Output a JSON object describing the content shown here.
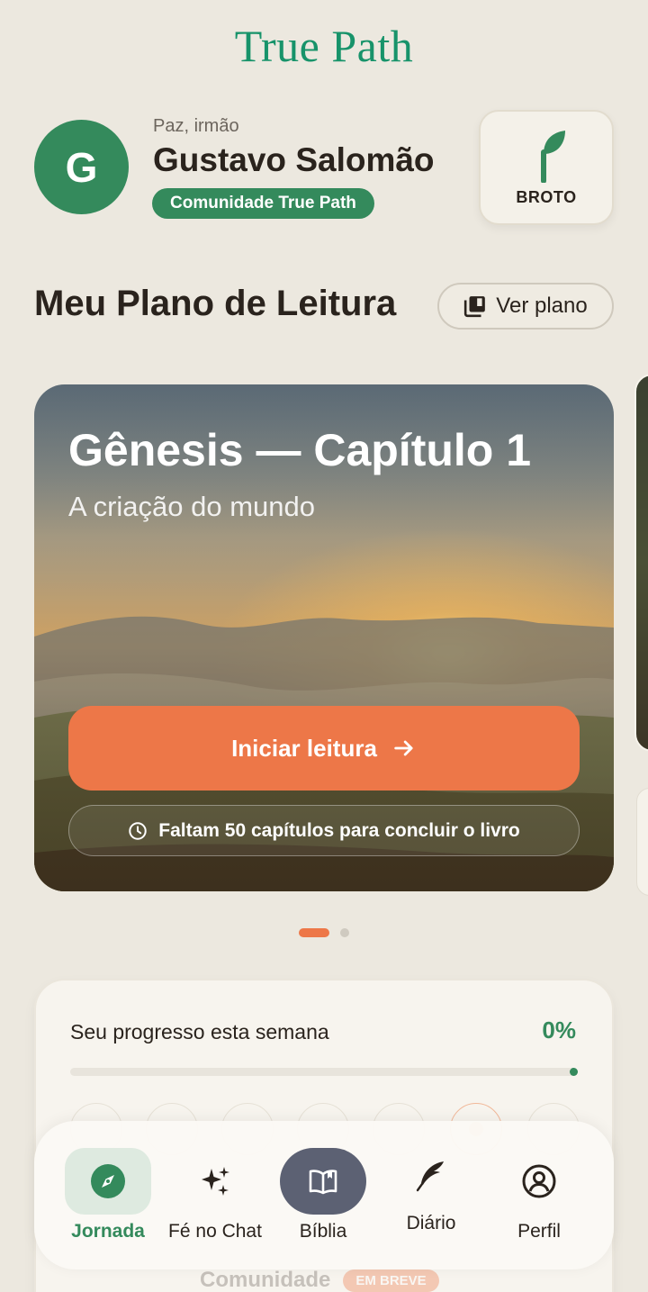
{
  "app": {
    "brand": "True Path"
  },
  "profile": {
    "greeting": "Paz, irmão",
    "name": "Gustavo Salomão",
    "initial": "G",
    "community_badge": "Comunidade True Path",
    "level_label": "BROTO",
    "level_icon": "sprout-icon"
  },
  "reading_plan": {
    "title": "Meu Plano de Leitura",
    "view_plan_label": "Ver plano",
    "card": {
      "title": "Gênesis — Capítulo 1",
      "subtitle": "A criação do mundo",
      "start_label": "Iniciar leitura",
      "remaining_text": "Faltam 50 capítulos para concluir o livro"
    },
    "carousel": {
      "total": 2,
      "active_index": 0
    }
  },
  "weekly_progress": {
    "label": "Seu progresso esta semana",
    "value_text": "0%",
    "value": 0
  },
  "community_teaser": {
    "label": "Comunidade",
    "badge": "EM BREVE"
  },
  "bottom_nav": {
    "items": [
      {
        "label": "Jornada",
        "icon": "compass-icon",
        "active": true
      },
      {
        "label": "Fé no Chat",
        "icon": "sparkles-icon",
        "active": false
      },
      {
        "label": "Bíblia",
        "icon": "open-book-icon",
        "active": false
      },
      {
        "label": "Diário",
        "icon": "quill-icon",
        "active": false
      },
      {
        "label": "Perfil",
        "icon": "user-circle-icon",
        "active": false
      }
    ]
  },
  "colors": {
    "background": "#ece8df",
    "brand_green": "#17936a",
    "primary_green": "#348a5c",
    "accent_orange": "#ed7748",
    "bible_nav": "#5c6173"
  }
}
